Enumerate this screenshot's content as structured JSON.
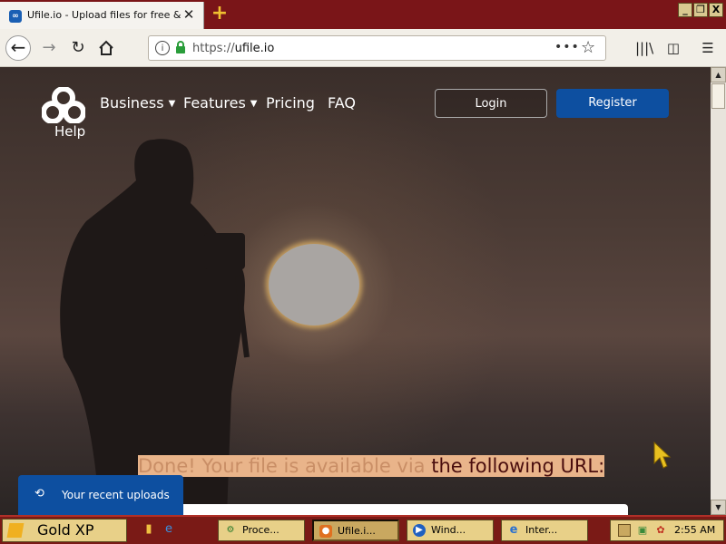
{
  "browser": {
    "tab_title": "Ufile.io - Upload files for free & sh",
    "tab_favicon": "ufile-logo-icon",
    "new_tab_label": "+",
    "window_buttons": [
      "_",
      "❐",
      "X"
    ],
    "url_scheme": "https://",
    "url_host": "ufile.io",
    "url_dots": "•••"
  },
  "site": {
    "nav": {
      "business": "Business",
      "features": "Features",
      "pricing": "Pricing",
      "faq": "FAQ",
      "help": "Help"
    },
    "login_label": "Login",
    "register_label": "Register",
    "done_part1": "Done! Your file is available via ",
    "done_part2": "the following URL:",
    "recent_uploads_label": "Your recent uploads"
  },
  "taskbar": {
    "start_label": "Gold XP",
    "tasks": [
      {
        "label": "Proce...",
        "icon": "process-icon"
      },
      {
        "label": "Ufile.i...",
        "icon": "firefox-icon",
        "active": true
      },
      {
        "label": "Wind...",
        "icon": "media-player-icon"
      },
      {
        "label": "Inter...",
        "icon": "internet-explorer-icon"
      }
    ],
    "clock": "2:55 AM"
  },
  "colors": {
    "title_bar": "#7a1518",
    "accent_blue": "#0d4fa0",
    "taskbar": "#7a1a16",
    "taskbar_button": "#e8d088"
  }
}
